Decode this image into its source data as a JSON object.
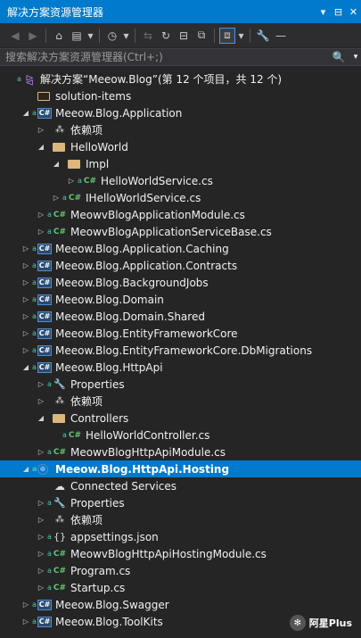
{
  "title": "解决方案资源管理器",
  "title_buttons": [
    "▾",
    "⊟",
    "✕"
  ],
  "toolbar": {
    "buttons": [
      {
        "name": "back-icon",
        "glyph": "◀",
        "dim": true
      },
      {
        "name": "forward-icon",
        "glyph": "▶",
        "dim": true
      },
      {
        "name": "home-icon",
        "glyph": "⌂",
        "dim": false
      },
      {
        "name": "switch-views-icon",
        "glyph": "▤",
        "dim": false
      },
      {
        "name": "dropdown-icon",
        "glyph": "▾",
        "dim": false
      },
      {
        "name": "pending-changes-icon",
        "glyph": "◷",
        "dim": false
      },
      {
        "name": "dropdown-icon",
        "glyph": "▾",
        "dim": false
      },
      {
        "name": "sync-icon",
        "glyph": "⇆",
        "dim": true
      },
      {
        "name": "refresh-icon",
        "glyph": "↻",
        "dim": false
      },
      {
        "name": "collapse-all-icon",
        "glyph": "⊟",
        "dim": false
      },
      {
        "name": "show-all-files-icon",
        "glyph": "⧉",
        "dim": false
      },
      {
        "name": "preview-icon",
        "glyph": "⧈",
        "dim": false,
        "selected": true
      },
      {
        "name": "dropdown-icon",
        "glyph": "▾",
        "dim": false
      },
      {
        "name": "properties-icon",
        "glyph": "🔧",
        "dim": false
      },
      {
        "name": "minus-icon",
        "glyph": "—",
        "dim": false
      }
    ]
  },
  "search": {
    "placeholder": "搜索解决方案资源管理器(Ctrl+;)",
    "icon": "🔍"
  },
  "tree": [
    {
      "label": "解决方案“Meeow.Blog”(第 12 个项目，共 12 个)",
      "level": 0,
      "icon": "sln",
      "expander": "",
      "lock": true
    },
    {
      "label": "solution-items",
      "level": 1,
      "icon": "folder",
      "expander": ""
    },
    {
      "label": "Meeow.Blog.Application",
      "level": 1,
      "icon": "csproj",
      "expander": "open",
      "lock": true
    },
    {
      "label": "依赖项",
      "level": 2,
      "icon": "dep",
      "expander": "closed"
    },
    {
      "label": "HelloWorld",
      "level": 2,
      "icon": "folder-open",
      "expander": "open"
    },
    {
      "label": "Impl",
      "level": 3,
      "icon": "folder-open",
      "expander": "open"
    },
    {
      "label": "HelloWorldService.cs",
      "level": 4,
      "icon": "cs",
      "expander": "closed",
      "lock": true
    },
    {
      "label": "IHelloWorldService.cs",
      "level": 3,
      "icon": "cs",
      "expander": "closed",
      "lock": true
    },
    {
      "label": "MeowvBlogApplicationModule.cs",
      "level": 2,
      "icon": "cs",
      "expander": "closed",
      "lock": true
    },
    {
      "label": "MeowvBlogApplicationServiceBase.cs",
      "level": 2,
      "icon": "cs",
      "expander": "closed",
      "lock": true
    },
    {
      "label": "Meeow.Blog.Application.Caching",
      "level": 1,
      "icon": "csproj",
      "expander": "closed",
      "lock": true
    },
    {
      "label": "Meeow.Blog.Application.Contracts",
      "level": 1,
      "icon": "csproj",
      "expander": "closed",
      "lock": true
    },
    {
      "label": "Meeow.Blog.BackgroundJobs",
      "level": 1,
      "icon": "csproj",
      "expander": "closed",
      "lock": true
    },
    {
      "label": "Meeow.Blog.Domain",
      "level": 1,
      "icon": "csproj",
      "expander": "closed",
      "lock": true
    },
    {
      "label": "Meeow.Blog.Domain.Shared",
      "level": 1,
      "icon": "csproj",
      "expander": "closed",
      "lock": true
    },
    {
      "label": "Meeow.Blog.EntityFrameworkCore",
      "level": 1,
      "icon": "csproj",
      "expander": "closed",
      "lock": true
    },
    {
      "label": "Meeow.Blog.EntityFrameworkCore.DbMigrations",
      "level": 1,
      "icon": "csproj",
      "expander": "closed",
      "lock": true
    },
    {
      "label": "Meeow.Blog.HttpApi",
      "level": 1,
      "icon": "csproj",
      "expander": "open",
      "lock": true
    },
    {
      "label": "Properties",
      "level": 2,
      "icon": "wrench",
      "expander": "closed",
      "lock": true
    },
    {
      "label": "依赖项",
      "level": 2,
      "icon": "dep",
      "expander": "closed"
    },
    {
      "label": "Controllers",
      "level": 2,
      "icon": "folder-open",
      "expander": "open"
    },
    {
      "label": "HelloWorldController.cs",
      "level": 3,
      "icon": "cs",
      "expander": "",
      "lock": true
    },
    {
      "label": "MeowvBlogHttpApiModule.cs",
      "level": 2,
      "icon": "cs",
      "expander": "closed",
      "lock": true
    },
    {
      "label": "Meeow.Blog.HttpApi.Hosting",
      "level": 1,
      "icon": "web",
      "expander": "open",
      "lock": true,
      "selected": true
    },
    {
      "label": "Connected Services",
      "level": 2,
      "icon": "svc",
      "expander": ""
    },
    {
      "label": "Properties",
      "level": 2,
      "icon": "wrench",
      "expander": "closed",
      "lock": true
    },
    {
      "label": "依赖项",
      "level": 2,
      "icon": "dep",
      "expander": "closed"
    },
    {
      "label": "appsettings.json",
      "level": 2,
      "icon": "json",
      "expander": "closed",
      "lock": true
    },
    {
      "label": "MeowvBlogHttpApiHostingModule.cs",
      "level": 2,
      "icon": "cs",
      "expander": "closed",
      "lock": true
    },
    {
      "label": "Program.cs",
      "level": 2,
      "icon": "cs",
      "expander": "closed",
      "lock": true
    },
    {
      "label": "Startup.cs",
      "level": 2,
      "icon": "cs",
      "expander": "closed",
      "lock": true
    },
    {
      "label": "Meeow.Blog.Swagger",
      "level": 1,
      "icon": "csproj",
      "expander": "closed",
      "lock": true
    },
    {
      "label": "Meeow.Blog.ToolKits",
      "level": 1,
      "icon": "csproj",
      "expander": "closed",
      "lock": true
    }
  ],
  "watermark": {
    "text": "阿星Plus"
  },
  "colors": {
    "accent": "#007acc",
    "background": "#252526"
  }
}
